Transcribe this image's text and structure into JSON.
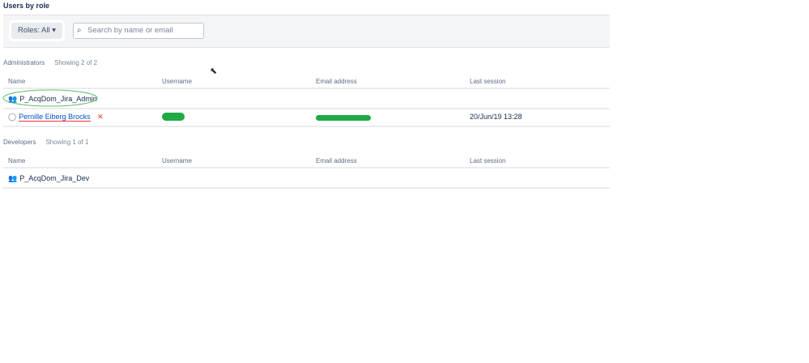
{
  "page_title": "Users by role",
  "toolbar": {
    "roles_label": "Roles: All",
    "search_placeholder": "Search by name or email"
  },
  "columns": [
    "Name",
    "Username",
    "Email address",
    "Last session"
  ],
  "sections": [
    {
      "title": "Administrators",
      "count": "Showing 2 of 2",
      "rows": [
        {
          "name": "P_AcqDom_Jira_Admin",
          "type": "group",
          "username": "",
          "email": "",
          "last_session": ""
        },
        {
          "name": "Pernille Eiberg Brocks",
          "type": "user",
          "username": "",
          "email": "",
          "last_session": "20/Jun/19 13:28"
        }
      ]
    },
    {
      "title": "Developers",
      "count": "Showing 1 of 1",
      "rows": [
        {
          "name": "P_AcqDom_Jira_Dev",
          "type": "group",
          "username": "",
          "email": "",
          "last_session": ""
        }
      ]
    }
  ]
}
